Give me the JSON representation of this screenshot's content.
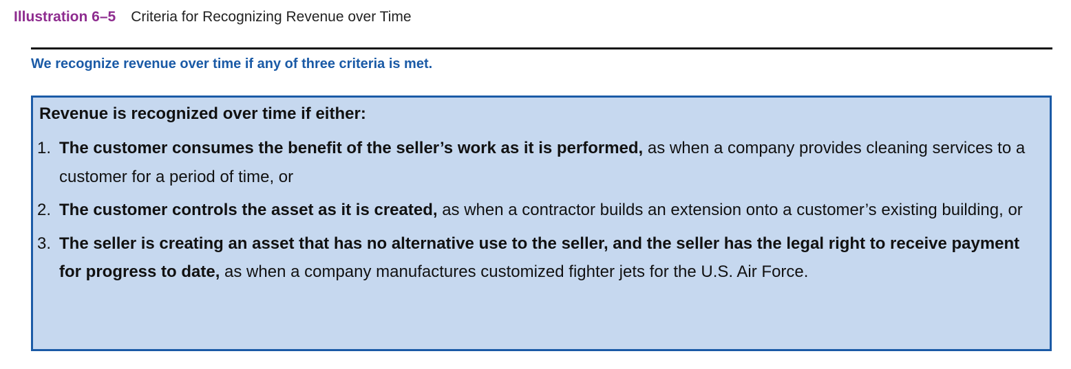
{
  "header": {
    "label": "Illustration 6–5",
    "title": "Criteria for Recognizing Revenue over Time"
  },
  "subheading": "We recognize revenue over time if any of three criteria is met.",
  "box": {
    "heading": "Revenue is recognized over time if either:",
    "criteria": [
      {
        "number": "1.",
        "lead": "The customer consumes the benefit of the seller’s work as it is performed,",
        "rest": " as when a company provides cleaning services to a customer for a period of time, or"
      },
      {
        "number": "2.",
        "lead": "The customer controls the asset as it is created,",
        "rest": " as when a contractor builds an extension onto a customer’s existing building, or"
      },
      {
        "number": "3.",
        "lead": "The seller is creating an asset that has no alternative use to the seller, and the seller has the legal right to receive payment for progress to date,",
        "rest": " as when a company manufactures customized fighter jets for the U.S. Air Force."
      }
    ]
  },
  "colors": {
    "illustration_label": "#8e2c8f",
    "subheading": "#1a5aa6",
    "box_fill": "#c6d8ef",
    "box_border": "#1a5aa6"
  }
}
